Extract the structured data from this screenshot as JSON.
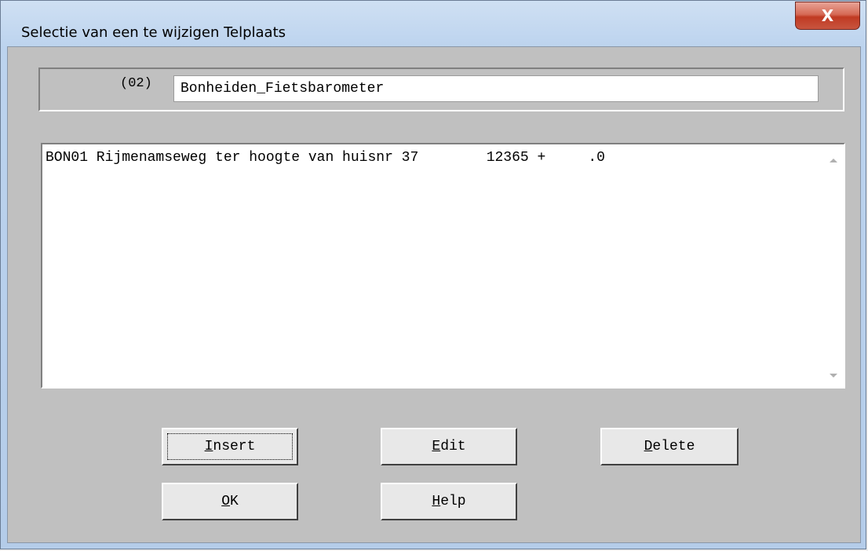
{
  "window": {
    "title": "Selectie van een te wijzigen Telplaats",
    "close_symbol": "X"
  },
  "header": {
    "code": "(02)",
    "name": "Bonheiden_Fietsbarometer"
  },
  "list": {
    "rows": [
      "BON01 Rijmenamseweg ter hoogte van huisnr 37        12365 +     .0"
    ]
  },
  "buttons": {
    "insert": {
      "acc": "I",
      "rest": "nsert"
    },
    "edit": {
      "acc": "E",
      "rest": "dit"
    },
    "delete": {
      "acc": "D",
      "rest": "elete"
    },
    "ok": {
      "acc": "O",
      "rest": "K"
    },
    "help": {
      "acc": "H",
      "rest": "elp"
    }
  },
  "colors": {
    "dialog_bg": "#c0c0c0",
    "close_button": "#c8553f"
  },
  "icons": {
    "close": "close-icon",
    "scroll_up": "scroll-up-arrow-icon",
    "scroll_down": "scroll-down-arrow-icon"
  }
}
